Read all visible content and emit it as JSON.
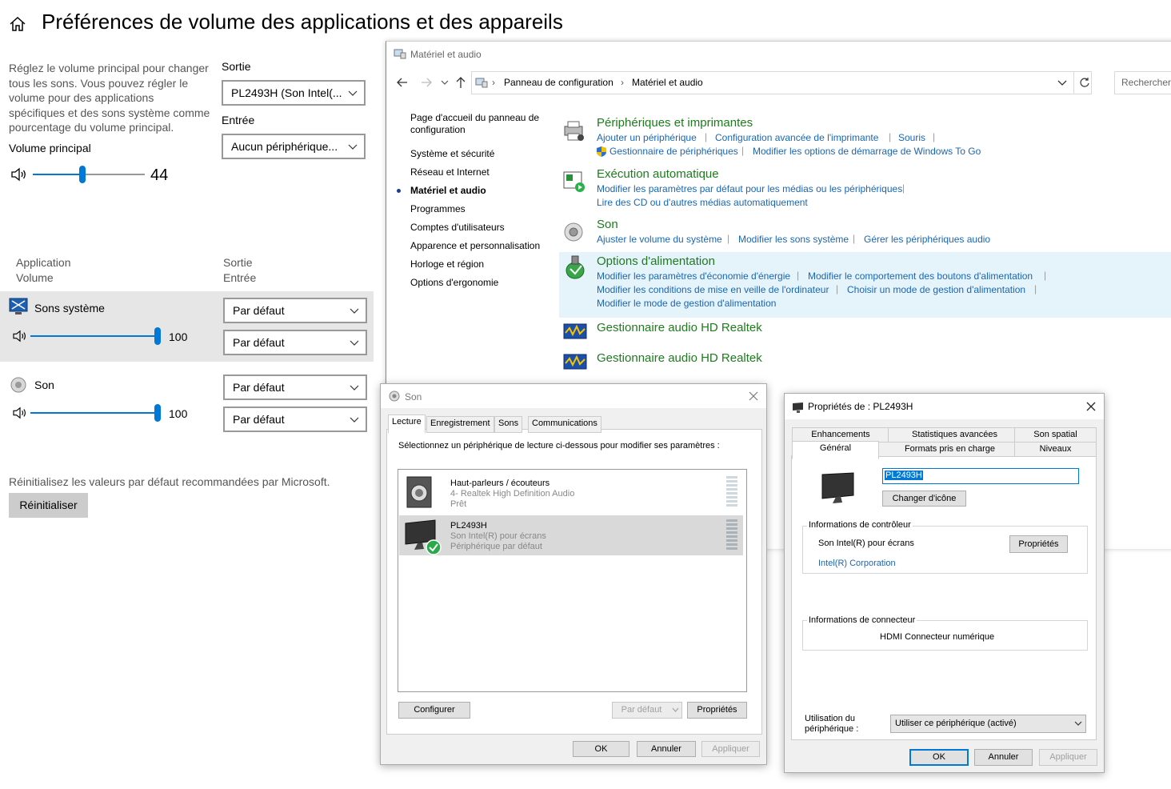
{
  "settings": {
    "title": "Préférences de volume des applications et des appareils",
    "description": "Réglez le volume principal pour changer tous les sons. Vous pouvez régler le volume pour des applications spécifiques et des sons système comme pourcentage du volume principal.",
    "master_label": "Volume principal",
    "master_value": "44",
    "master_level": 44,
    "output_label": "Sortie",
    "output_value": "PL2493H (Son Intel(...",
    "input_label": "Entrée",
    "input_value": "Aucun périphérique...",
    "col_app": "Application",
    "col_volume": "Volume",
    "col_out": "Sortie",
    "col_in": "Entrée",
    "apps": [
      {
        "name": "Sons système",
        "value": "100",
        "level": 100,
        "out": "Par défaut",
        "in": "Par défaut"
      },
      {
        "name": "Son",
        "value": "100",
        "level": 100,
        "out": "Par défaut",
        "in": "Par défaut"
      }
    ],
    "reset_text": "Réinitialisez les valeurs par défaut recommandées par Microsoft.",
    "reset_button": "Réinitialiser"
  },
  "control_panel": {
    "title": "Matériel et audio",
    "breadcrumb": [
      "Panneau de configuration",
      "Matériel et audio"
    ],
    "search_placeholder": "Rechercher",
    "nav": [
      "Page d'accueil du panneau de configuration",
      "Système et sécurité",
      "Réseau et Internet",
      "Matériel et audio",
      "Programmes",
      "Comptes d'utilisateurs",
      "Apparence et personnalisation",
      "Horloge et région",
      "Options d'ergonomie"
    ],
    "categories": [
      {
        "title": "Périphériques et imprimantes",
        "links": [
          "Ajouter un périphérique",
          "Configuration avancée de l'imprimante",
          "Souris",
          "Gestionnaire de périphériques",
          "Modifier les options de démarrage de Windows To Go"
        ]
      },
      {
        "title": "Exécution automatique",
        "links": [
          "Modifier les paramètres par défaut pour les médias ou les périphériques",
          "Lire des CD ou d'autres médias automatiquement"
        ]
      },
      {
        "title": "Son",
        "links": [
          "Ajuster le volume du système",
          "Modifier les sons système",
          "Gérer les périphériques audio"
        ]
      },
      {
        "title": "Options d'alimentation",
        "links": [
          "Modifier les paramètres d'économie d'énergie",
          "Modifier le comportement des boutons d'alimentation",
          "Modifier les conditions de mise en veille de l'ordinateur",
          "Choisir un mode de gestion d'alimentation",
          "Modifier le mode de gestion d'alimentation"
        ]
      },
      {
        "title": "Gestionnaire audio HD Realtek",
        "links": []
      },
      {
        "title": "Gestionnaire audio HD Realtek",
        "links": []
      }
    ]
  },
  "son_dialog": {
    "title": "Son",
    "tabs": [
      "Lecture",
      "Enregistrement",
      "Sons",
      "Communications"
    ],
    "instruction": "Sélectionnez un périphérique de lecture ci-dessous pour modifier ses paramètres :",
    "devices": [
      {
        "name": "Haut-parleurs / écouteurs",
        "line2": "4- Realtek High Definition Audio",
        "line3": "Prêt"
      },
      {
        "name": "PL2493H",
        "line2": "Son Intel(R) pour écrans",
        "line3": "Périphérique par défaut"
      }
    ],
    "configure": "Configurer",
    "set_default": "Par défaut",
    "properties": "Propriétés",
    "ok": "OK",
    "cancel": "Annuler",
    "apply": "Appliquer"
  },
  "props_dialog": {
    "title": "Propriétés de : PL2493H",
    "tabs_top": [
      "Enhancements",
      "Statistiques avancées",
      "Son spatial"
    ],
    "tabs_bottom": [
      "Général",
      "Formats pris en charge",
      "Niveaux"
    ],
    "name_value": "PL2493H",
    "change_icon": "Changer d'icône",
    "controller_group": "Informations de contrôleur",
    "controller_name": "Son Intel(R) pour écrans",
    "controller_vendor": "Intel(R) Corporation",
    "controller_props": "Propriétés",
    "connector_group": "Informations de connecteur",
    "connector_value": "HDMI Connecteur numérique",
    "usage_label_1": "Utilisation du",
    "usage_label_2": "périphérique :",
    "usage_value": "Utiliser ce périphérique (activé)",
    "ok": "OK",
    "cancel": "Annuler",
    "apply": "Appliquer"
  }
}
